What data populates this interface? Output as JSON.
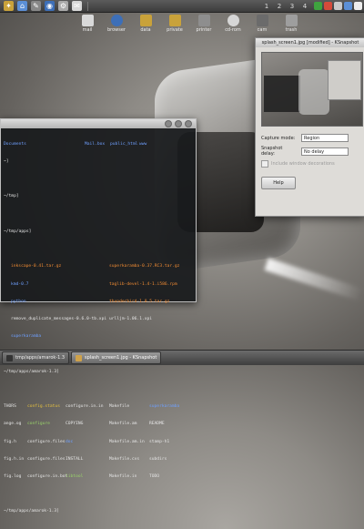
{
  "desktop_icons": [
    {
      "label": "mail",
      "icon": "mail-icon",
      "color": "#d9d9d9"
    },
    {
      "label": "browser",
      "icon": "browser-icon",
      "color": "#3d6fb8"
    },
    {
      "label": "data",
      "icon": "folder-icon",
      "color": "#c9a23a"
    },
    {
      "label": "private",
      "icon": "folder-icon",
      "color": "#c9a23a"
    },
    {
      "label": "printer",
      "icon": "printer-icon",
      "color": "#8e8e8e"
    },
    {
      "label": "cd-rom",
      "icon": "cdrom-icon",
      "color": "#d6d6d6"
    },
    {
      "label": "cam",
      "icon": "camera-icon",
      "color": "#6b6b6b"
    },
    {
      "label": "trash",
      "icon": "trash-icon",
      "color": "#9e9e9e"
    }
  ],
  "pager": [
    "1",
    "2",
    "3",
    "4"
  ],
  "terminal": {
    "header": [
      "Documents",
      "Mail.box",
      "public_html",
      "www"
    ],
    "lines": [
      {
        "text": "~]",
        "cls": "c-white"
      },
      {
        "text": "",
        "cls": "c-white"
      },
      {
        "text": "~/tmp]",
        "cls": "c-white"
      },
      {
        "text": "",
        "cls": "c-white"
      },
      {
        "text": "~/tmp/apps]",
        "cls": "c-white"
      },
      {
        "text": "",
        "cls": "c-white"
      }
    ],
    "listing": [
      [
        "inkscape-0.41.tar.gz",
        "superkaramba-0.37.RC3.tar.gz"
      ],
      [
        "kmd-0.7",
        "taglib-devel-1.4-1.i586.rpm"
      ],
      [
        "python",
        "thunderbird-1.0.5.tar.gz"
      ],
      [
        "remove_duplicate_messages-0.6.0-tb.xpi",
        "urlljm-1.06.1.xpi"
      ],
      [
        "superkaramba",
        ""
      ]
    ],
    "amarok_prompt": "~/tmp/apps/amarok-1.3]",
    "amarok_listing": [
      [
        "THORS",
        "config.status",
        "configure.in.in",
        "Makefile",
        "superkaramba"
      ],
      [
        "ange.og",
        "configure",
        "COPYING",
        "Makefile.am",
        "README"
      ],
      [
        "fig.h",
        "configure.files",
        "doc",
        "Makefile.am.in",
        "stamp-h1"
      ],
      [
        "fig.h.in",
        "configure.files",
        "INSTALL",
        "Makefile.cvs",
        "subdirs"
      ],
      [
        "fig.log",
        "configure.in.bot",
        "libtool",
        "Makefile.in",
        "TODO"
      ]
    ],
    "final_prompt": "~/tmp/apps/amarok-1.3]"
  },
  "ksnapshot": {
    "title": "splash_screen1.jpg [modified] - KSnapshot",
    "capture_mode_label": "Capture mode:",
    "capture_mode_value": "Region",
    "snapshot_delay_label": "Snapshot delay:",
    "snapshot_delay_value": "No delay",
    "checkbox_label": "Include window decorations",
    "help_label": "Help"
  },
  "taskbar": {
    "tasks": [
      {
        "label": "tmp/apps/amarok-1.3",
        "active": false
      },
      {
        "label": "splash_screen1.jpg - KSnapshot",
        "active": true
      }
    ]
  },
  "colors": {
    "panel": "#4a4a4a",
    "terminal_bg": "#181a1c",
    "window_bg": "#dedcd8"
  }
}
